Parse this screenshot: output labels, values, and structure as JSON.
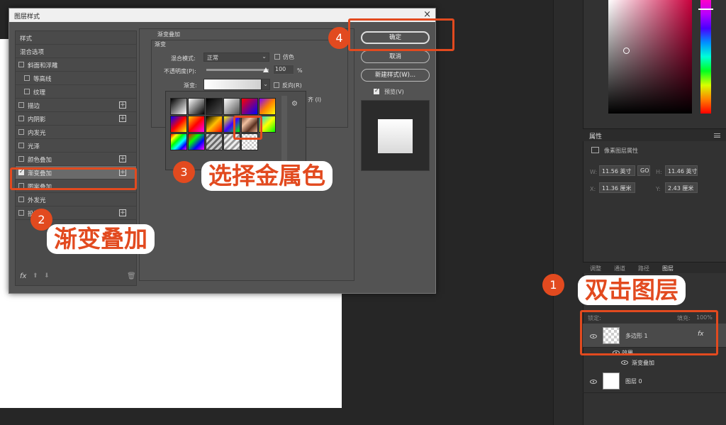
{
  "dialog": {
    "title": "图层样式",
    "close": "×",
    "styles_header": "样式",
    "blend_options": "混合选项",
    "items": [
      {
        "label": "斜面和浮雕",
        "checked": false,
        "plus": false,
        "indent": false
      },
      {
        "label": "等高线",
        "checked": false,
        "plus": false,
        "indent": true
      },
      {
        "label": "纹理",
        "checked": false,
        "plus": false,
        "indent": true
      },
      {
        "label": "描边",
        "checked": false,
        "plus": true,
        "indent": false
      },
      {
        "label": "内阴影",
        "checked": false,
        "plus": true,
        "indent": false
      },
      {
        "label": "内发光",
        "checked": false,
        "plus": false,
        "indent": false
      },
      {
        "label": "光泽",
        "checked": false,
        "plus": false,
        "indent": false
      },
      {
        "label": "颜色叠加",
        "checked": false,
        "plus": true,
        "indent": false
      },
      {
        "label": "渐变叠加",
        "checked": true,
        "plus": true,
        "indent": false
      },
      {
        "label": "图案叠加",
        "checked": false,
        "plus": false,
        "indent": false
      },
      {
        "label": "外发光",
        "checked": false,
        "plus": false,
        "indent": false
      },
      {
        "label": "投影",
        "checked": false,
        "plus": true,
        "indent": false
      }
    ],
    "fx_label": "fx",
    "section_title": "渐变叠加",
    "sub_title": "渐变",
    "blend_mode_label": "混合模式:",
    "blend_mode_value": "正常",
    "dither_label": "仿色",
    "opacity_label": "不透明度(P):",
    "opacity_value": "100",
    "opacity_unit": "%",
    "opacity_level": 1.0,
    "gradient_label": "渐变:",
    "reverse_label": "反向(R)",
    "align_label": "齐 (I)",
    "ok": "确定",
    "cancel": "取消",
    "new_style": "新建样式(W)...",
    "preview": "预览(V)"
  },
  "gradients": [
    "linear-gradient(135deg,#000,#fff)",
    "linear-gradient(135deg,#fff,#000)",
    "linear-gradient(135deg,#000,rgba(0,0,0,0))",
    "linear-gradient(135deg,#fff,rgba(255,255,255,0))",
    "linear-gradient(135deg,#ff0000,#0000ff)",
    "linear-gradient(135deg,#8000ff,#ff8000,#ffff00)",
    "linear-gradient(135deg,#0000ff,#ff0000,#ffff00)",
    "linear-gradient(135deg,#ffcc00,#ff0000,#ff00ff)",
    "linear-gradient(135deg,#000,#ffc000,#ff0000)",
    "linear-gradient(135deg,#ffff00,#4000ff,#00ff00)",
    "linear-gradient(135deg,#6b3a2a,#f0c0a0,#5a3020,#e8b090)",
    "linear-gradient(135deg,#00d0ff,#ffff00,#00ff00)",
    "linear-gradient(135deg,#ff0000,#ffff00,#00ff00,#00ffff,#0000ff,#ff00ff)",
    "linear-gradient(135deg,#ff0000,#00ff00,#0000ff,#ff00ff)",
    "repeating-linear-gradient(135deg,#ccc 0 3px,#666 3px 6px)",
    "repeating-linear-gradient(135deg,#eee 0 3px,#999 3px 6px)",
    "repeating-conic-gradient(#ccc 0% 25%,#fff 0% 50%) 50%/6px 6px"
  ],
  "properties": {
    "title": "属性",
    "subtitle": "像素图层属性",
    "w_label": "W:",
    "w_value": "11.56 英寸",
    "h_label": "H:",
    "h_value": "11.46 英寸",
    "x_label": "X:",
    "x_value": "11.36 厘米",
    "y_label": "Y:",
    "y_value": "2.43 厘米",
    "link": "GO"
  },
  "layers": {
    "tabs": [
      "调整",
      "通道",
      "路径",
      "图层"
    ],
    "lock_label": "锁定:",
    "fill_label": "填充:",
    "fill_value": "100%",
    "items": [
      {
        "name": "多边形 1",
        "fx": "fx",
        "effects_label": "效果",
        "effect": "渐变叠加"
      },
      {
        "name": "图层 0"
      }
    ]
  },
  "annotations": {
    "step1_num": "1",
    "step1_text": "双击图层",
    "step2_num": "2",
    "step2_text": "渐变叠加",
    "step3_num": "3",
    "step3_text": "选择金属色",
    "step4_num": "4",
    "accent_color": "#e24a1f"
  }
}
